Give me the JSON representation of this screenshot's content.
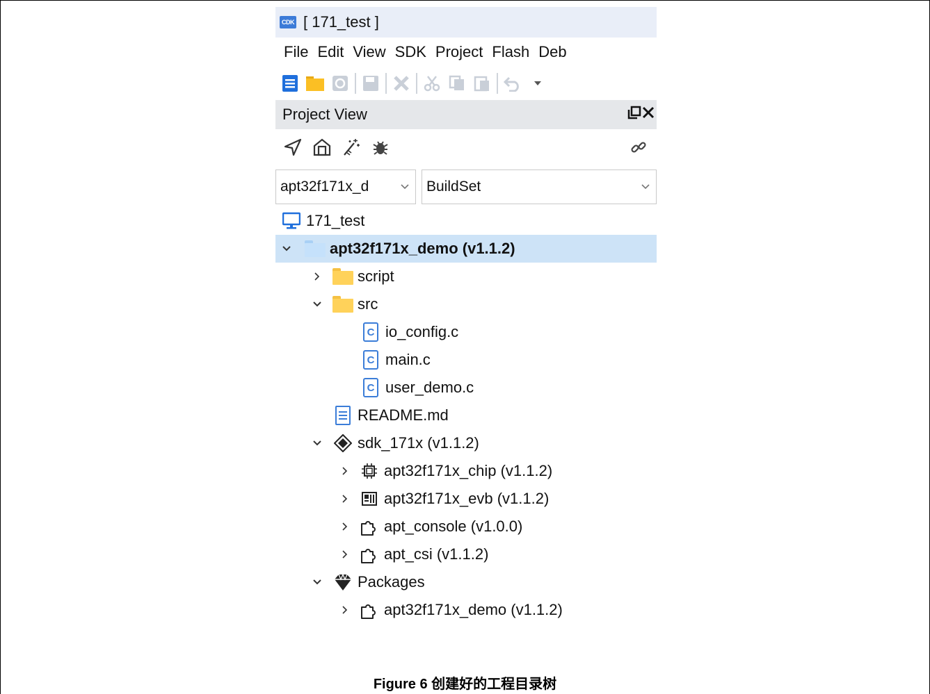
{
  "window": {
    "title": "[ 171_test ]",
    "app_logo_text": "CDK"
  },
  "menu": [
    "File",
    "Edit",
    "View",
    "SDK",
    "Project",
    "Flash",
    "Deb"
  ],
  "toolbar_icons": [
    "new-file-icon",
    "open-folder-icon",
    "refresh-icon",
    "save-icon",
    "close-icon",
    "cut-icon",
    "copy-icon",
    "paste-icon",
    "undo-icon",
    "dropdown-icon"
  ],
  "panel": {
    "title": "Project View",
    "controls": [
      "float-icon",
      "close-icon"
    ]
  },
  "panel_toolbar_icons": [
    "locate-icon",
    "home-icon",
    "magic-wand-icon",
    "bug-icon",
    "link-icon"
  ],
  "selects": {
    "target": "apt32f171x_d",
    "buildset": "BuildSet"
  },
  "tree": [
    {
      "label": "171_test",
      "icon": "monitor-icon",
      "depth": 0,
      "twisty": "",
      "selected": false,
      "bold": false
    },
    {
      "label": "apt32f171x_demo (v1.1.2)",
      "icon": "folder-blue-icon",
      "depth": 0,
      "twisty": "expanded",
      "selected": true,
      "bold": true
    },
    {
      "label": "script",
      "icon": "folder-icon",
      "depth": 1,
      "twisty": "collapsed",
      "selected": false,
      "bold": false
    },
    {
      "label": "src",
      "icon": "folder-icon",
      "depth": 1,
      "twisty": "expanded",
      "selected": false,
      "bold": false
    },
    {
      "label": "io_config.c",
      "icon": "c-file-icon",
      "depth": 2,
      "twisty": "",
      "selected": false,
      "bold": false
    },
    {
      "label": "main.c",
      "icon": "c-file-icon",
      "depth": 2,
      "twisty": "",
      "selected": false,
      "bold": false
    },
    {
      "label": "user_demo.c",
      "icon": "c-file-icon",
      "depth": 2,
      "twisty": "",
      "selected": false,
      "bold": false
    },
    {
      "label": "README.md",
      "icon": "document-icon",
      "depth": 1,
      "twisty": "",
      "selected": false,
      "bold": false
    },
    {
      "label": "sdk_171x (v1.1.2)",
      "icon": "sdk-diamond-icon",
      "depth": 1,
      "twisty": "expanded",
      "selected": false,
      "bold": false
    },
    {
      "label": "apt32f171x_chip (v1.1.2)",
      "icon": "chip-icon",
      "depth": 2,
      "twisty": "collapsed",
      "selected": false,
      "bold": false
    },
    {
      "label": "apt32f171x_evb (v1.1.2)",
      "icon": "board-icon",
      "depth": 2,
      "twisty": "collapsed",
      "selected": false,
      "bold": false
    },
    {
      "label": "apt_console (v1.0.0)",
      "icon": "puzzle-icon",
      "depth": 2,
      "twisty": "collapsed",
      "selected": false,
      "bold": false
    },
    {
      "label": "apt_csi (v1.1.2)",
      "icon": "puzzle-icon",
      "depth": 2,
      "twisty": "collapsed",
      "selected": false,
      "bold": false
    },
    {
      "label": "Packages",
      "icon": "packages-icon",
      "depth": 1,
      "twisty": "expanded",
      "selected": false,
      "bold": false
    },
    {
      "label": "apt32f171x_demo (v1.1.2)",
      "icon": "puzzle-icon",
      "depth": 2,
      "twisty": "collapsed",
      "selected": false,
      "bold": false
    }
  ],
  "caption": "Figure 6  创建好的工程目录树"
}
